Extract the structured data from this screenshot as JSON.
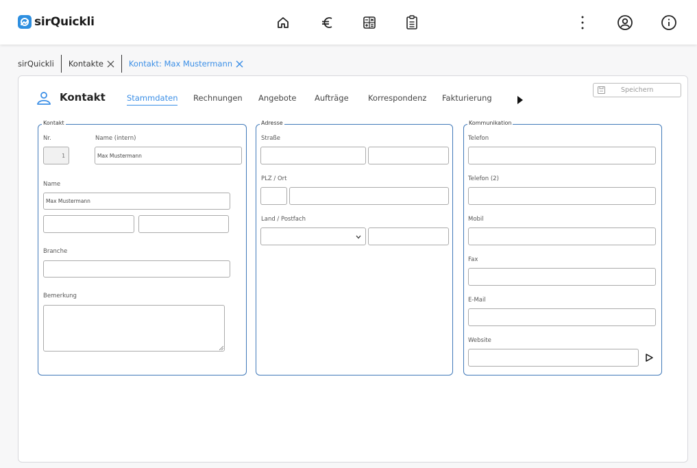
{
  "app": {
    "brand": "sirQuickli",
    "accent_color": "#3a8ee6",
    "border_color": "#3f78b8"
  },
  "nav": {
    "icons": [
      "home-icon",
      "euro-icon",
      "calculator-icon",
      "clipboard-icon"
    ],
    "right_icons": [
      "more-vertical-icon",
      "user-circle-icon",
      "info-icon"
    ]
  },
  "breadcrumbs": [
    {
      "label": "sirQuickli"
    },
    {
      "label": "Kontakte"
    },
    {
      "label": "Kontakt: Max Mustermann"
    }
  ],
  "card": {
    "title": "Kontakt",
    "save_label": "Speichern",
    "tabs": [
      "Stammdaten",
      "Rechnungen",
      "Angebote",
      "Aufträge",
      "Korrespondenz",
      "Fakturierung"
    ]
  },
  "kontakt": {
    "legend": "Kontakt",
    "nr_label": "Nr.",
    "nr_value": "1",
    "name_intern_label": "Name (intern)",
    "name_intern_value": "Max Mustermann",
    "name_label": "Name",
    "name_value": "Max Mustermann",
    "name2_value": "",
    "name3_value": "",
    "branche_label": "Branche",
    "branche_value": "",
    "bemerkung_label": "Bemerkung",
    "bemerkung_value": ""
  },
  "adresse": {
    "legend": "Adresse",
    "strasse_label": "Straße",
    "plz_ort_label": "PLZ / Ort",
    "land_postfach_label": "Land / Postfach",
    "land_value": ""
  },
  "kommunikation": {
    "legend": "Kommunikation",
    "telefon_label": "Telefon",
    "telefon2_label": "Telefon (2)",
    "mobil_label": "Mobil",
    "fax_label": "Fax",
    "email_label": "E-Mail",
    "website_label": "Website"
  }
}
